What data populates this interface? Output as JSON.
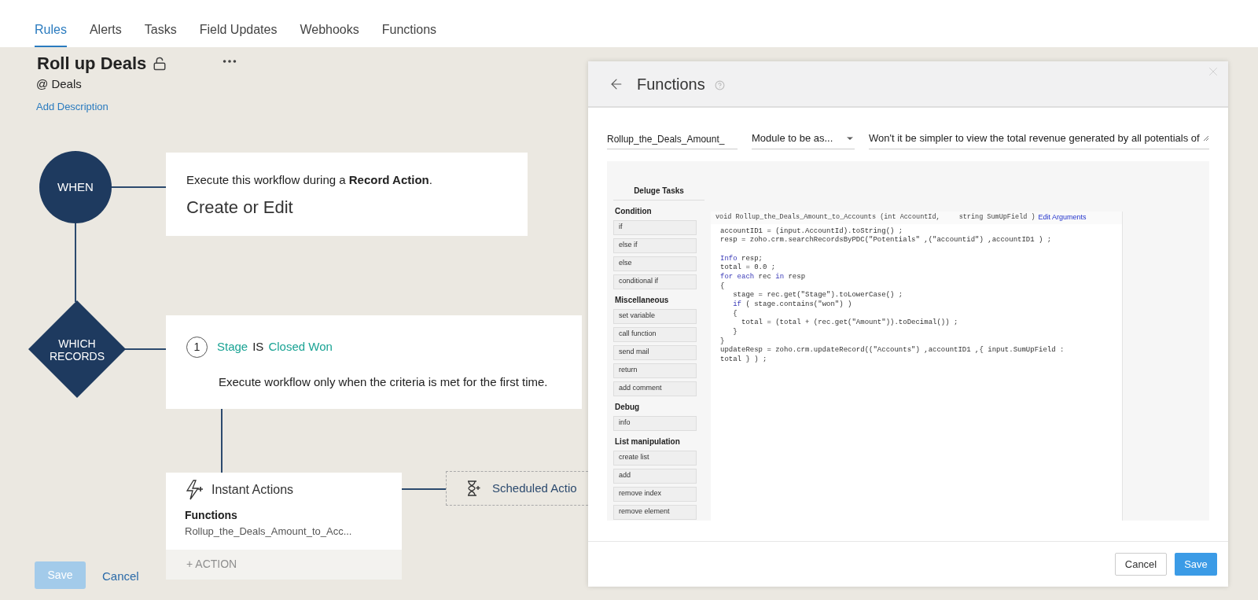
{
  "tabs": [
    {
      "label": "Rules",
      "selected": true
    },
    {
      "label": "Alerts",
      "selected": false
    },
    {
      "label": "Tasks",
      "selected": false
    },
    {
      "label": "Field Updates",
      "selected": false
    },
    {
      "label": "Webhooks",
      "selected": false
    },
    {
      "label": "Functions",
      "selected": false
    }
  ],
  "rule": {
    "title": "Roll up Deals",
    "module": "@ Deals",
    "add_description": "Add Description"
  },
  "when": {
    "label": "WHEN",
    "intro": "Execute this workflow during a **Record Action**.",
    "trigger": "Create or Edit"
  },
  "which": {
    "label": "WHICH RECORDS",
    "criteria": [
      {
        "number": "1",
        "field": "Stage",
        "operator": "IS",
        "value": "Closed Won"
      }
    ],
    "note": "Execute workflow only when the criteria is met for the first time."
  },
  "instant_actions": {
    "title": "Instant Actions",
    "items": [
      {
        "heading": "Functions",
        "name": "Rollup_the_Deals_Amount_to_Acc..."
      }
    ],
    "add_action": "+ ACTION"
  },
  "scheduled_actions": {
    "title": "Scheduled Actio"
  },
  "footer": {
    "save": {
      "label": "Save",
      "disabled": true
    },
    "cancel": "Cancel"
  },
  "panel": {
    "title": "Functions",
    "name_value": "Rollup_the_Deals_Amount_",
    "module_value": "Module to be as...",
    "description_value": "Won't it be simpler to view the total revenue generated by all potentials of",
    "tasks_title": "Deluge Tasks",
    "sections": [
      {
        "title": "Condition",
        "items": [
          "if",
          "else if",
          "else",
          "conditional if"
        ]
      },
      {
        "title": "Miscellaneous",
        "items": [
          "set variable",
          "call function",
          "send mail",
          "return",
          "add comment"
        ]
      },
      {
        "title": "Debug",
        "items": [
          "info"
        ]
      },
      {
        "title": "List manipulation",
        "items": [
          "create list",
          "add",
          "remove index",
          "remove element"
        ]
      }
    ],
    "signature": [
      "void Rollup_the_Deals_Amount_to_Accounts (int AccountId,",
      "string SumUpField )"
    ],
    "edit_arguments": "Edit Arguments",
    "code": [
      [
        [
          {
            "text": "accountID1 = (input.AccountId).toString() ;",
            "kind": "plain"
          }
        ],
        [
          {
            "text": "resp = zoho.crm.searchRecordsByPDC(\"Potentials\" ,(\"accountid\") ,accountID1 ) ;",
            "kind": "plain"
          }
        ]
      ],
      [
        [
          {
            "text": "Info",
            "kind": "keyword"
          },
          {
            "text": " resp;",
            "kind": "plain"
          }
        ],
        [
          {
            "text": "total = 0.0 ;",
            "kind": "plain"
          }
        ],
        [
          {
            "text": "for each",
            "kind": "keyword"
          },
          {
            "text": " rec ",
            "kind": "plain"
          },
          {
            "text": "in",
            "kind": "keyword"
          },
          {
            "text": " resp",
            "kind": "plain"
          }
        ],
        [
          {
            "text": "{",
            "kind": "plain"
          }
        ],
        [
          {
            "text": "   stage = rec.get(\"Stage\").toLowerCase() ;",
            "kind": "plain"
          }
        ],
        [
          {
            "text": "   if",
            "kind": "keyword"
          },
          {
            "text": " ( stage.contains(\"won\") )",
            "kind": "plain"
          }
        ],
        [
          {
            "text": "   {",
            "kind": "plain"
          }
        ],
        [
          {
            "text": "     total = (total + (rec.get(\"Amount\")).toDecimal()) ;",
            "kind": "plain"
          }
        ],
        [
          {
            "text": "   }",
            "kind": "plain"
          }
        ],
        [
          {
            "text": "}",
            "kind": "plain"
          }
        ],
        [
          {
            "text": "updateResp = zoho.crm.updateRecord((\"Accounts\") ,accountID1 ,{ input.SumUpField :",
            "kind": "plain"
          }
        ],
        [
          {
            "text": "total } ) ;",
            "kind": "plain"
          }
        ]
      ]
    ],
    "cancel": "Cancel",
    "save": "Save"
  }
}
